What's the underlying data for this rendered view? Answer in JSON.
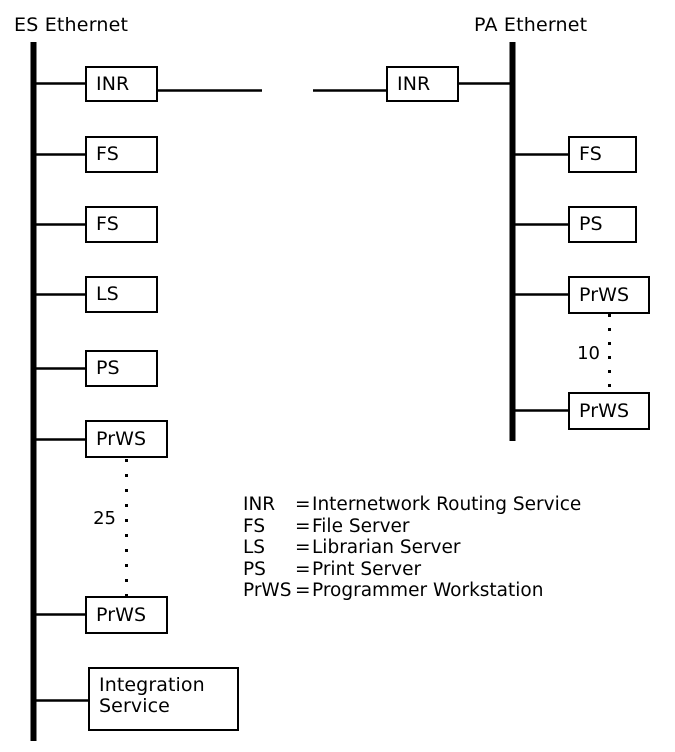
{
  "diagram": {
    "title_left": "ES Ethernet",
    "title_right": "PA Ethernet",
    "line_color": "#000000",
    "background_color": "#ffffff"
  },
  "networks": [
    {
      "id": "es",
      "label": "ES Ethernet",
      "nodes": [
        {
          "label": "INR"
        },
        {
          "label": "FS"
        },
        {
          "label": "FS"
        },
        {
          "label": "LS"
        },
        {
          "label": "PS"
        },
        {
          "label": "PrWS"
        },
        {
          "label": "PrWS"
        },
        {
          "label": "Integration\nService"
        }
      ],
      "repeat_count": "25"
    },
    {
      "id": "pa",
      "label": "PA Ethernet",
      "nodes": [
        {
          "label": "INR"
        },
        {
          "label": "FS"
        },
        {
          "label": "PS"
        },
        {
          "label": "PrWS"
        },
        {
          "label": "PrWS"
        }
      ],
      "repeat_count": "10"
    }
  ],
  "legend": [
    {
      "abbr": "INR",
      "eq": "=",
      "meaning": "Internetwork Routing Service"
    },
    {
      "abbr": "FS",
      "eq": "=",
      "meaning": "File Server"
    },
    {
      "abbr": "LS",
      "eq": "=",
      "meaning": "Librarian Server"
    },
    {
      "abbr": "PS",
      "eq": "=",
      "meaning": "Print Server"
    },
    {
      "abbr": "PrWS",
      "eq": "=",
      "meaning": "Programmer Workstation"
    }
  ]
}
